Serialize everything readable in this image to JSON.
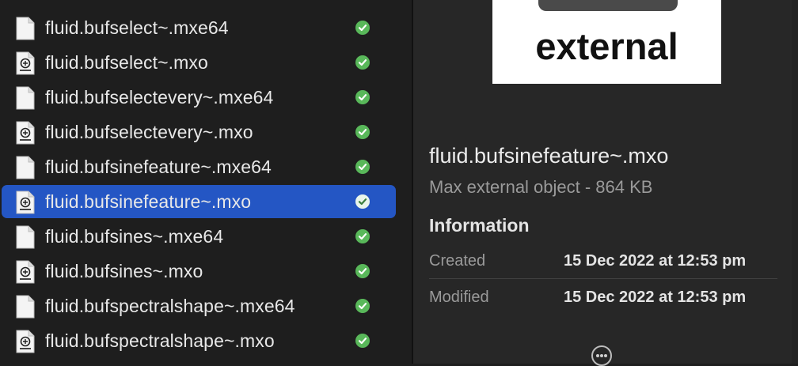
{
  "files": [
    {
      "name": "fluid.bufselect~.mxe64",
      "kind": "document",
      "status": "synced",
      "selected": false
    },
    {
      "name": "fluid.bufselect~.mxo",
      "kind": "external",
      "status": "synced",
      "selected": false
    },
    {
      "name": "fluid.bufselectevery~.mxe64",
      "kind": "document",
      "status": "synced",
      "selected": false
    },
    {
      "name": "fluid.bufselectevery~.mxo",
      "kind": "external",
      "status": "synced",
      "selected": false
    },
    {
      "name": "fluid.bufsinefeature~.mxe64",
      "kind": "document",
      "status": "synced",
      "selected": false
    },
    {
      "name": "fluid.bufsinefeature~.mxo",
      "kind": "external",
      "status": "synced",
      "selected": true
    },
    {
      "name": "fluid.bufsines~.mxe64",
      "kind": "document",
      "status": "synced",
      "selected": false
    },
    {
      "name": "fluid.bufsines~.mxo",
      "kind": "external",
      "status": "synced",
      "selected": false
    },
    {
      "name": "fluid.bufspectralshape~.mxe64",
      "kind": "document",
      "status": "synced",
      "selected": false
    },
    {
      "name": "fluid.bufspectralshape~.mxo",
      "kind": "external",
      "status": "synced",
      "selected": false
    }
  ],
  "preview": {
    "thumbnail_text": "external",
    "title": "fluid.bufsinefeature~.mxo",
    "subtitle": "Max external object - 864 KB",
    "info_heading": "Information",
    "info": [
      {
        "label": "Created",
        "value": "15 Dec 2022 at 12:53 pm"
      },
      {
        "label": "Modified",
        "value": "15 Dec 2022 at 12:53 pm"
      }
    ],
    "more_icon": "ellipsis-circle-icon"
  },
  "colors": {
    "selection": "#2456c4",
    "status_ok": "#59b85a",
    "background_list": "#1e1e1e",
    "background_preview": "#272727"
  }
}
